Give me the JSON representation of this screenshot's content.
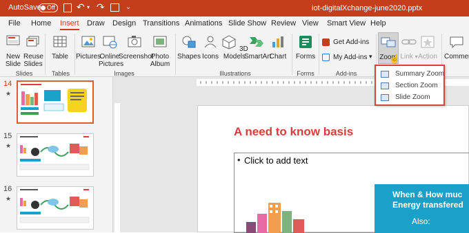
{
  "titlebar": {
    "autosave_label": "AutoSave",
    "autosave_state": "Off",
    "filename": "iot-digitalXchange-june2020.pptx"
  },
  "tabs": [
    "File",
    "Home",
    "Insert",
    "Draw",
    "Design",
    "Transitions",
    "Animations",
    "Slide Show",
    "Review",
    "View",
    "Smart View",
    "Help"
  ],
  "ribbon": {
    "new_slide": "New Slide",
    "reuse_slides": "Reuse Slides",
    "group_slides": "Slides",
    "table": "Table",
    "group_tables": "Tables",
    "pictures": "Pictures",
    "online_pictures": "Online Pictures",
    "screenshot": "Screenshot",
    "photo_album": "Photo Album",
    "group_images": "Images",
    "shapes": "Shapes",
    "icons": "Icons",
    "models_3d": "3D Models",
    "smartart": "SmartArt",
    "chart": "Chart",
    "group_illustrations": "Illustrations",
    "forms": "Forms",
    "group_forms": "Forms",
    "get_addins": "Get Add-ins",
    "my_addins": "My Add-ins",
    "group_addins": "Add-ins",
    "zoom": "Zoom",
    "link": "Link",
    "action": "Action",
    "comment": "Comment"
  },
  "zoom_menu": {
    "items": [
      "Summary Zoom",
      "Section Zoom",
      "Slide Zoom"
    ]
  },
  "thumbnails": [
    {
      "number": "14",
      "star": "★"
    },
    {
      "number": "15",
      "star": "★"
    },
    {
      "number": "16",
      "star": "★"
    }
  ],
  "slide": {
    "title": "A need to know basis",
    "bullet": "Click to add text",
    "callout_line1": "When & How muc",
    "callout_line2": "Energy transfered",
    "callout_line3": "Also:"
  },
  "colors": {
    "accent": "#c43e1c",
    "title_red": "#e03a3a",
    "callout_teal": "#1ba1c7",
    "highlight_red": "#d9423c"
  }
}
